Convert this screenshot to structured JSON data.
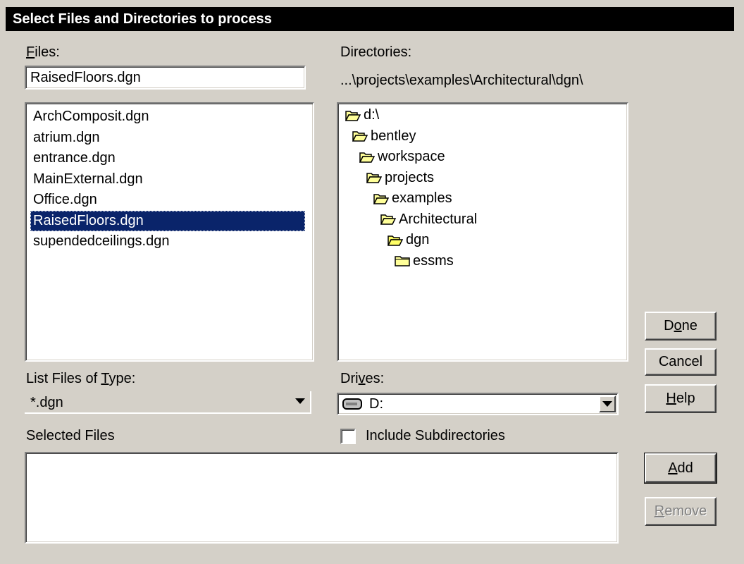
{
  "window": {
    "title": "Select Files and Directories to process"
  },
  "files": {
    "label_pre": "",
    "label_ul": "F",
    "label_post": "iles:",
    "value": "RaisedFloors.dgn",
    "items": [
      "ArchComposit.dgn",
      "atrium.dgn",
      "entrance.dgn",
      "MainExternal.dgn",
      "Office.dgn",
      "RaisedFloors.dgn",
      "supendedceilings.dgn"
    ],
    "selected_index": 5
  },
  "directories": {
    "label": "Directories:",
    "path": "...\\projects\\examples\\Architectural\\dgn\\",
    "tree": [
      {
        "label": "d:\\",
        "depth": 0,
        "open": true
      },
      {
        "label": "bentley",
        "depth": 1,
        "open": true
      },
      {
        "label": "workspace",
        "depth": 2,
        "open": true
      },
      {
        "label": "projects",
        "depth": 3,
        "open": true
      },
      {
        "label": "examples",
        "depth": 4,
        "open": true
      },
      {
        "label": "Architectural",
        "depth": 5,
        "open": true
      },
      {
        "label": "dgn",
        "depth": 6,
        "open": true,
        "current": true
      },
      {
        "label": "essms",
        "depth": 7,
        "open": false
      }
    ]
  },
  "file_type": {
    "label_pre": "List Files of ",
    "label_ul": "T",
    "label_post": "ype:",
    "value": "*.dgn"
  },
  "drives": {
    "label_pre": "Dri",
    "label_ul": "v",
    "label_post": "es:",
    "value": "D:"
  },
  "selected_files": {
    "label": "Selected Files",
    "items": []
  },
  "include_subdirs": {
    "label": "Include Subdirectories",
    "checked": false
  },
  "buttons": {
    "done": {
      "pre": "D",
      "ul": "o",
      "post": "ne"
    },
    "cancel": {
      "pre": "Cancel",
      "ul": "",
      "post": ""
    },
    "help": {
      "pre": "",
      "ul": "H",
      "post": "elp"
    },
    "add": {
      "pre": "",
      "ul": "A",
      "post": "dd"
    },
    "remove": {
      "pre": "",
      "ul": "R",
      "post": "emove",
      "disabled": true
    }
  },
  "colors": {
    "selection": "#0a246a",
    "face": "#d4d0c8",
    "folder": "#ffff99"
  }
}
